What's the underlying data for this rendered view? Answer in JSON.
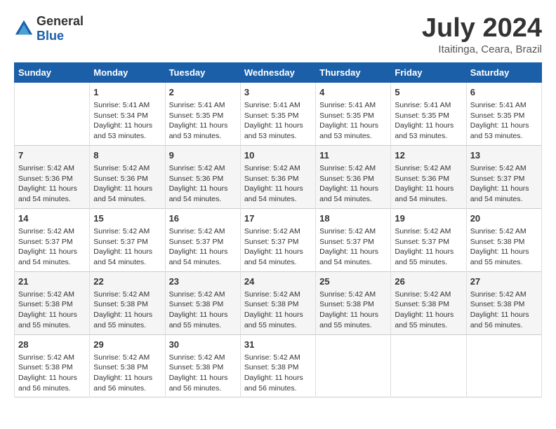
{
  "logo": {
    "text_general": "General",
    "text_blue": "Blue"
  },
  "title": "July 2024",
  "subtitle": "Itaitinga, Ceara, Brazil",
  "weekdays": [
    "Sunday",
    "Monday",
    "Tuesday",
    "Wednesday",
    "Thursday",
    "Friday",
    "Saturday"
  ],
  "weeks": [
    [
      {
        "day": null,
        "info": null
      },
      {
        "day": "1",
        "info": "Sunrise: 5:41 AM\nSunset: 5:34 PM\nDaylight: 11 hours\nand 53 minutes."
      },
      {
        "day": "2",
        "info": "Sunrise: 5:41 AM\nSunset: 5:35 PM\nDaylight: 11 hours\nand 53 minutes."
      },
      {
        "day": "3",
        "info": "Sunrise: 5:41 AM\nSunset: 5:35 PM\nDaylight: 11 hours\nand 53 minutes."
      },
      {
        "day": "4",
        "info": "Sunrise: 5:41 AM\nSunset: 5:35 PM\nDaylight: 11 hours\nand 53 minutes."
      },
      {
        "day": "5",
        "info": "Sunrise: 5:41 AM\nSunset: 5:35 PM\nDaylight: 11 hours\nand 53 minutes."
      },
      {
        "day": "6",
        "info": "Sunrise: 5:41 AM\nSunset: 5:35 PM\nDaylight: 11 hours\nand 53 minutes."
      }
    ],
    [
      {
        "day": "7",
        "info": "Sunrise: 5:42 AM\nSunset: 5:36 PM\nDaylight: 11 hours\nand 54 minutes."
      },
      {
        "day": "8",
        "info": "Sunrise: 5:42 AM\nSunset: 5:36 PM\nDaylight: 11 hours\nand 54 minutes."
      },
      {
        "day": "9",
        "info": "Sunrise: 5:42 AM\nSunset: 5:36 PM\nDaylight: 11 hours\nand 54 minutes."
      },
      {
        "day": "10",
        "info": "Sunrise: 5:42 AM\nSunset: 5:36 PM\nDaylight: 11 hours\nand 54 minutes."
      },
      {
        "day": "11",
        "info": "Sunrise: 5:42 AM\nSunset: 5:36 PM\nDaylight: 11 hours\nand 54 minutes."
      },
      {
        "day": "12",
        "info": "Sunrise: 5:42 AM\nSunset: 5:36 PM\nDaylight: 11 hours\nand 54 minutes."
      },
      {
        "day": "13",
        "info": "Sunrise: 5:42 AM\nSunset: 5:37 PM\nDaylight: 11 hours\nand 54 minutes."
      }
    ],
    [
      {
        "day": "14",
        "info": "Sunrise: 5:42 AM\nSunset: 5:37 PM\nDaylight: 11 hours\nand 54 minutes."
      },
      {
        "day": "15",
        "info": "Sunrise: 5:42 AM\nSunset: 5:37 PM\nDaylight: 11 hours\nand 54 minutes."
      },
      {
        "day": "16",
        "info": "Sunrise: 5:42 AM\nSunset: 5:37 PM\nDaylight: 11 hours\nand 54 minutes."
      },
      {
        "day": "17",
        "info": "Sunrise: 5:42 AM\nSunset: 5:37 PM\nDaylight: 11 hours\nand 54 minutes."
      },
      {
        "day": "18",
        "info": "Sunrise: 5:42 AM\nSunset: 5:37 PM\nDaylight: 11 hours\nand 54 minutes."
      },
      {
        "day": "19",
        "info": "Sunrise: 5:42 AM\nSunset: 5:37 PM\nDaylight: 11 hours\nand 55 minutes."
      },
      {
        "day": "20",
        "info": "Sunrise: 5:42 AM\nSunset: 5:38 PM\nDaylight: 11 hours\nand 55 minutes."
      }
    ],
    [
      {
        "day": "21",
        "info": "Sunrise: 5:42 AM\nSunset: 5:38 PM\nDaylight: 11 hours\nand 55 minutes."
      },
      {
        "day": "22",
        "info": "Sunrise: 5:42 AM\nSunset: 5:38 PM\nDaylight: 11 hours\nand 55 minutes."
      },
      {
        "day": "23",
        "info": "Sunrise: 5:42 AM\nSunset: 5:38 PM\nDaylight: 11 hours\nand 55 minutes."
      },
      {
        "day": "24",
        "info": "Sunrise: 5:42 AM\nSunset: 5:38 PM\nDaylight: 11 hours\nand 55 minutes."
      },
      {
        "day": "25",
        "info": "Sunrise: 5:42 AM\nSunset: 5:38 PM\nDaylight: 11 hours\nand 55 minutes."
      },
      {
        "day": "26",
        "info": "Sunrise: 5:42 AM\nSunset: 5:38 PM\nDaylight: 11 hours\nand 55 minutes."
      },
      {
        "day": "27",
        "info": "Sunrise: 5:42 AM\nSunset: 5:38 PM\nDaylight: 11 hours\nand 56 minutes."
      }
    ],
    [
      {
        "day": "28",
        "info": "Sunrise: 5:42 AM\nSunset: 5:38 PM\nDaylight: 11 hours\nand 56 minutes."
      },
      {
        "day": "29",
        "info": "Sunrise: 5:42 AM\nSunset: 5:38 PM\nDaylight: 11 hours\nand 56 minutes."
      },
      {
        "day": "30",
        "info": "Sunrise: 5:42 AM\nSunset: 5:38 PM\nDaylight: 11 hours\nand 56 minutes."
      },
      {
        "day": "31",
        "info": "Sunrise: 5:42 AM\nSunset: 5:38 PM\nDaylight: 11 hours\nand 56 minutes."
      },
      {
        "day": null,
        "info": null
      },
      {
        "day": null,
        "info": null
      },
      {
        "day": null,
        "info": null
      }
    ]
  ]
}
